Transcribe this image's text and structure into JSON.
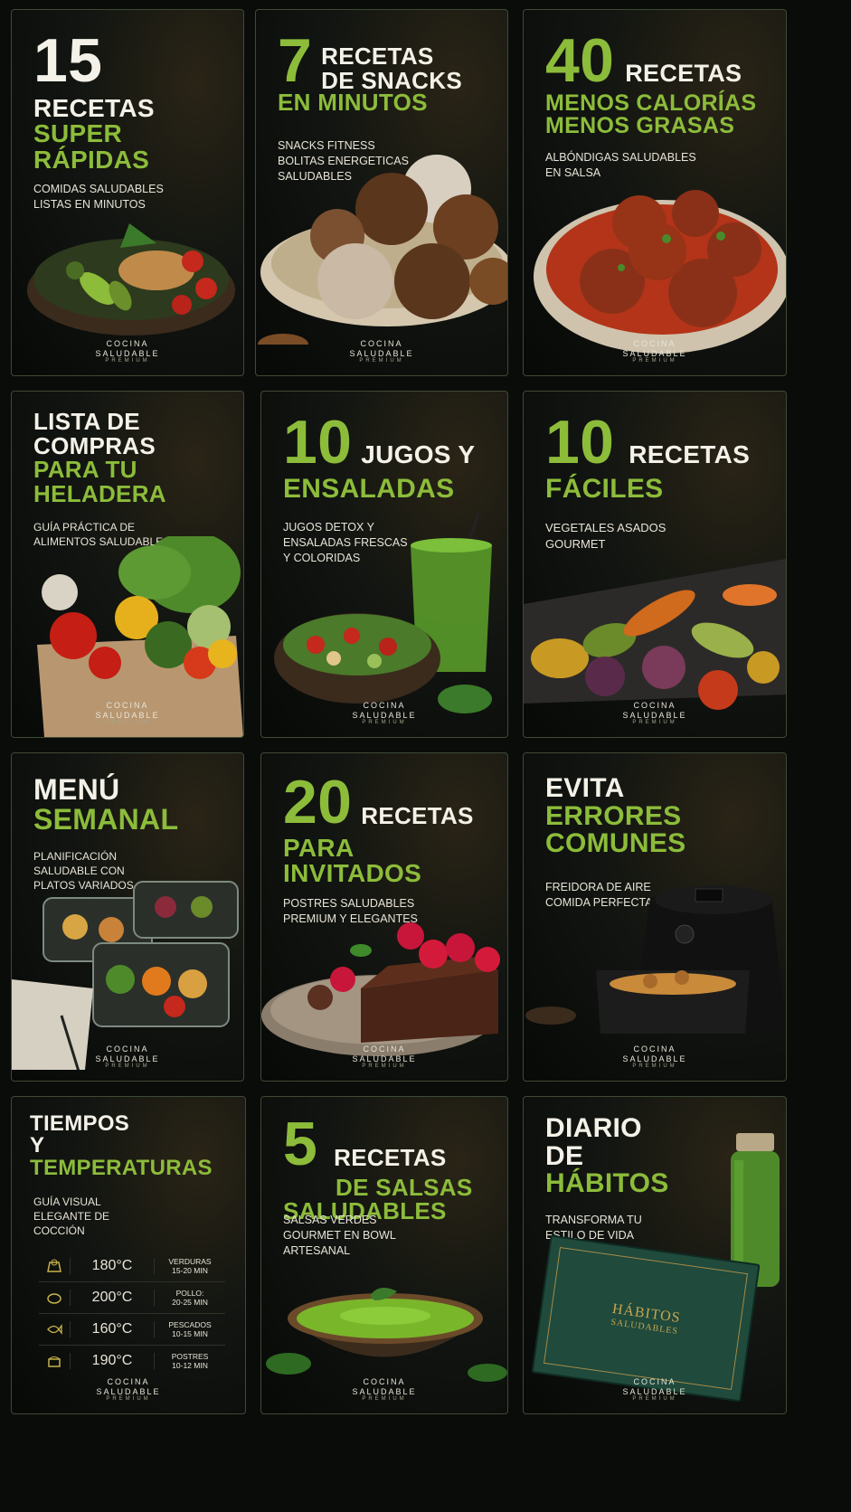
{
  "brand": {
    "line1": "COCINA",
    "line2": "SALUDABLE",
    "line3": "PREMIUM"
  },
  "colors": {
    "accent": "#8cbc3a",
    "text": "#f4f1e8",
    "bg": "#0b0d0b"
  },
  "cards": [
    {
      "num": "15",
      "l1": "RECETAS",
      "l2": "SUPER",
      "l3": "RÁPIDAS",
      "sub": [
        "COMIDAS SALUDABLES",
        "LISTAS EN MINUTOS"
      ]
    },
    {
      "num": "7",
      "l1": "RECETAS",
      "l2": "DE SNACKS",
      "l3": "EN MINUTOS",
      "sub": [
        "SNACKS FITNESS",
        "BOLITAS ENERGETICAS",
        "SALUDABLES"
      ]
    },
    {
      "num": "40",
      "l1": "RECETAS",
      "l2": "MENOS CALORÍAS",
      "l3": "MENOS GRASAS",
      "sub": [
        "ALBÓNDIGAS SALUDABLES",
        "EN SALSA"
      ]
    },
    {
      "l1": "LISTA DE",
      "l2": "COMPRAS",
      "l3": "PARA TU",
      "l4": "HELADERA",
      "sub": [
        "GUÍA PRÁCTICA DE",
        "ALIMENTOS SALUDABLES"
      ]
    },
    {
      "num": "10",
      "l1": "JUGOS Y",
      "l2": "ENSALADAS",
      "sub": [
        "JUGOS DETOX Y",
        "ENSALADAS FRESCAS",
        "Y COLORIDAS"
      ]
    },
    {
      "num": "10",
      "l1": "RECETAS",
      "l2": "FÁCILES",
      "sub": [
        "VEGETALES ASADOS",
        "GOURMET"
      ]
    },
    {
      "l1": "MENÚ",
      "l2": "SEMANAL",
      "sub": [
        "PLANIFICACIÓN",
        "SALUDABLE CON",
        "PLATOS VARIADOS"
      ]
    },
    {
      "num": "20",
      "l1": "RECETAS",
      "l2": "PARA",
      "l3": "INVITADOS",
      "sub": [
        "POSTRES SALUDABLES",
        "PREMIUM Y ELEGANTES"
      ]
    },
    {
      "l1": "EVITA",
      "l2": "ERRORES",
      "l3": "COMUNES",
      "sub": [
        "FREIDORA DE AIRE",
        "COMIDA PERFECTA"
      ]
    },
    {
      "l1": "TIEMPOS",
      "l2": "Y",
      "l3": "TEMPERATURAS",
      "sub": [
        "GUÍA VISUAL",
        "ELEGANTE DE",
        "COCCIÓN"
      ],
      "table": [
        {
          "temp": "180°C",
          "label1": "VERDURAS",
          "label2": "15-20 MIN"
        },
        {
          "temp": "200°C",
          "label1": "POLLO:",
          "label2": "20-25 MIN"
        },
        {
          "temp": "160°C",
          "label1": "PESCADOS",
          "label2": "10-15 MIN"
        },
        {
          "temp": "190°C",
          "label1": "POSTRES",
          "label2": "10-12 MIN"
        }
      ]
    },
    {
      "num": "5",
      "l1": "RECETAS",
      "l2": "DE SALSAS",
      "l3": "SALUDABLES",
      "sub": [
        "SALSAS VERDES",
        "GOURMET EN BOWL",
        "ARTESANAL"
      ]
    },
    {
      "l1": "DIARIO",
      "l2": "DE",
      "l3": "HÁBITOS",
      "sub": [
        "TRANSFORMA TU",
        "ESTILO DE VIDA"
      ],
      "book1": "HÁBITOS",
      "book2": "SALUDABLES"
    }
  ]
}
